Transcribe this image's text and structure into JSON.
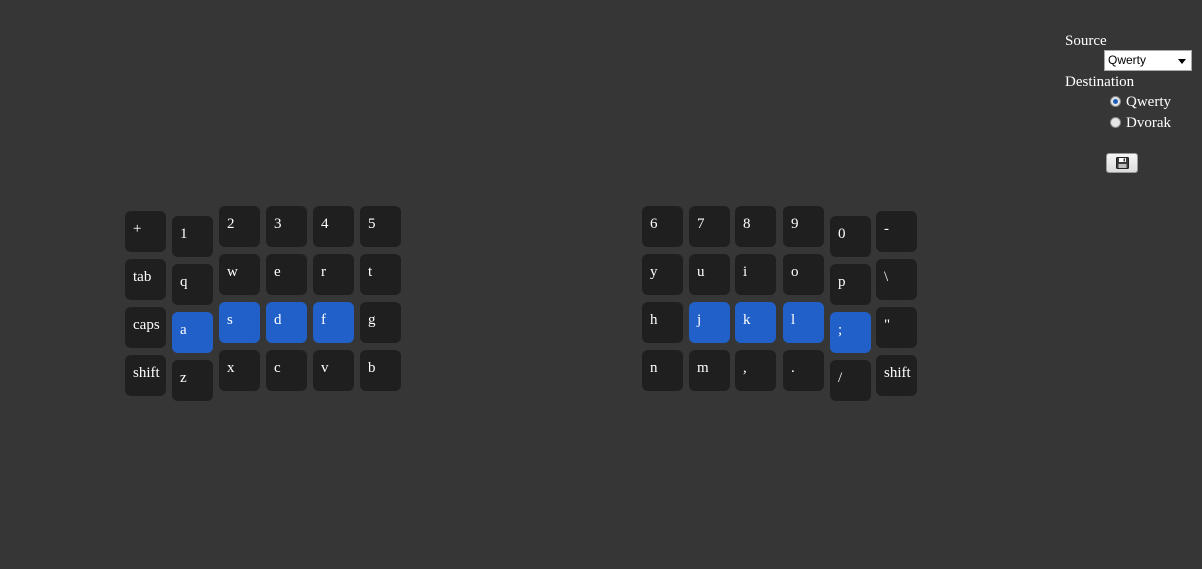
{
  "controls": {
    "source_label": "Source",
    "source_selected": "Qwerty",
    "destination_label": "Destination",
    "destination_options": [
      "Qwerty",
      "Dvorak"
    ],
    "destination_selected": "Qwerty",
    "save_icon": "floppy-disk-icon"
  },
  "keyboard": {
    "left": [
      "+",
      "1",
      "2",
      "3",
      "4",
      "5",
      "tab",
      "q",
      "w",
      "e",
      "r",
      "t",
      "caps",
      "a",
      "s",
      "d",
      "f",
      "g",
      "shift",
      "z",
      "x",
      "c",
      "v",
      "b"
    ],
    "right": [
      "6",
      "7",
      "8",
      "9",
      "0",
      "-",
      "y",
      "u",
      "i",
      "o",
      "p",
      "\\",
      "h",
      "j",
      "k",
      "l",
      ";",
      "\"",
      "n",
      "m",
      ",",
      ".",
      "/",
      "shift"
    ],
    "home_row_keys": [
      "a",
      "s",
      "d",
      "f",
      "j",
      "k",
      "l",
      ";"
    ]
  },
  "colors": {
    "background": "#363636",
    "key": "#1f1f1f",
    "home_key": "#2160c8",
    "text": "#ffffff"
  }
}
